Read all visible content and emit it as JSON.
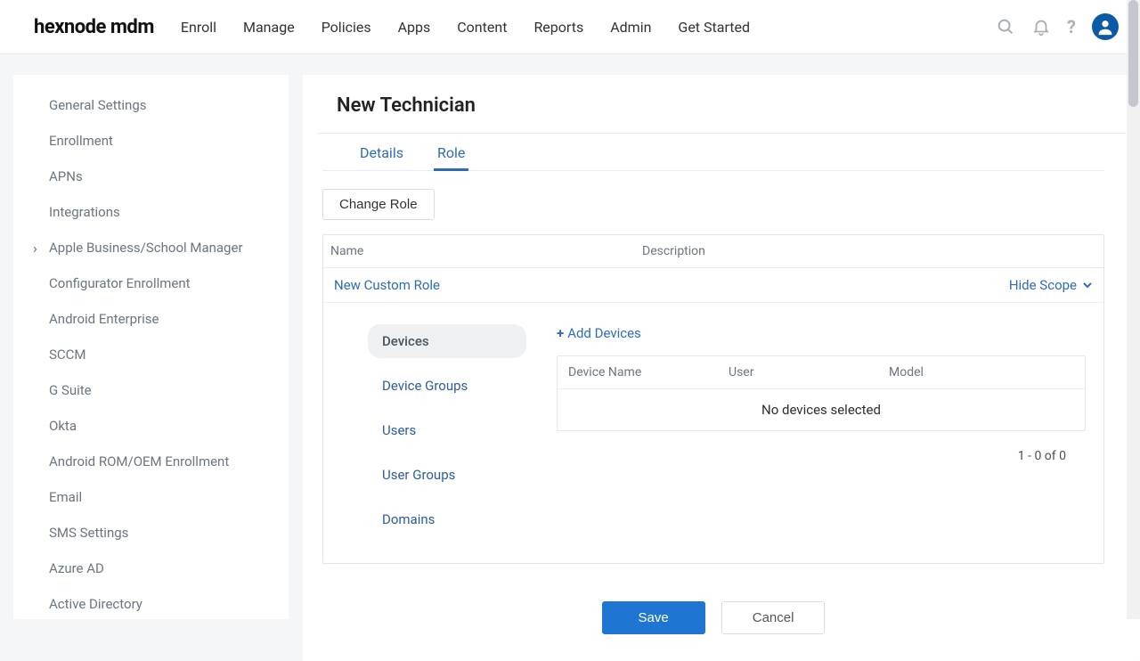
{
  "brand": "hexnode mdm",
  "nav": [
    "Enroll",
    "Manage",
    "Policies",
    "Apps",
    "Content",
    "Reports",
    "Admin",
    "Get Started"
  ],
  "sidebar": {
    "items": [
      {
        "label": "General Settings"
      },
      {
        "label": "Enrollment"
      },
      {
        "label": "APNs"
      },
      {
        "label": "Integrations"
      },
      {
        "label": "Apple Business/School Manager",
        "chevron": true
      },
      {
        "label": "Configurator Enrollment"
      },
      {
        "label": "Android Enterprise"
      },
      {
        "label": "SCCM"
      },
      {
        "label": "G Suite"
      },
      {
        "label": "Okta"
      },
      {
        "label": "Android ROM/OEM Enrollment"
      },
      {
        "label": "Email"
      },
      {
        "label": "SMS Settings"
      },
      {
        "label": "Azure AD"
      },
      {
        "label": "Active Directory"
      }
    ]
  },
  "page": {
    "title": "New Technician"
  },
  "tabs": {
    "details": "Details",
    "role": "Role"
  },
  "actions": {
    "change_role": "Change Role",
    "hide_scope": "Hide Scope",
    "add_devices": "Add Devices",
    "save": "Save",
    "cancel": "Cancel"
  },
  "role_table": {
    "headers": {
      "name": "Name",
      "description": "Description"
    },
    "row": {
      "name": "New Custom Role"
    }
  },
  "scope": {
    "tabs": [
      "Devices",
      "Device Groups",
      "Users",
      "User Groups",
      "Domains"
    ],
    "devices_table": {
      "headers": {
        "device_name": "Device Name",
        "user": "User",
        "model": "Model"
      },
      "empty": "No devices selected",
      "pager": "1 - 0 of 0"
    }
  }
}
